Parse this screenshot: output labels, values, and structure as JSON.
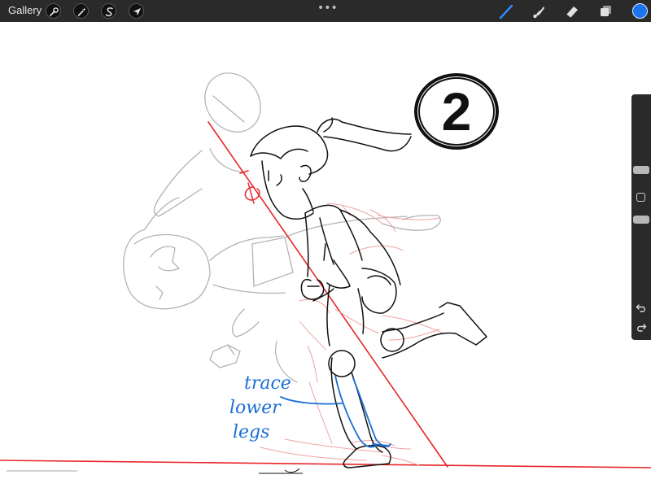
{
  "app": {
    "gallery_label": "Gallery",
    "menu_dots": "•••"
  },
  "toolbar_left": [
    {
      "name": "actions",
      "icon": "wrench-icon"
    },
    {
      "name": "adjustments",
      "icon": "magic-wand-icon"
    },
    {
      "name": "selection",
      "icon": "selection-s-icon"
    },
    {
      "name": "transform",
      "icon": "arrow-cursor-icon"
    }
  ],
  "toolbar_right": [
    {
      "name": "brush",
      "icon": "brush-icon",
      "active": true
    },
    {
      "name": "smudge",
      "icon": "smudge-icon"
    },
    {
      "name": "eraser",
      "icon": "eraser-icon"
    },
    {
      "name": "layers",
      "icon": "layers-icon"
    }
  ],
  "colors": {
    "toolbar_bg": "#2a2a2a",
    "accent": "#1d74f0",
    "current_color": "#1d74f0",
    "sketch_red": "#e8262b",
    "annotation_blue": "#1b6fd6"
  },
  "sidebar": {
    "brush_size": 0.12,
    "brush_opacity": 0.5,
    "undo_icon": "undo-icon",
    "redo_icon": "redo-icon"
  },
  "canvas": {
    "frame_number": "2",
    "annotation": {
      "line1": "trace",
      "line2": "lower",
      "line3": "legs"
    }
  }
}
